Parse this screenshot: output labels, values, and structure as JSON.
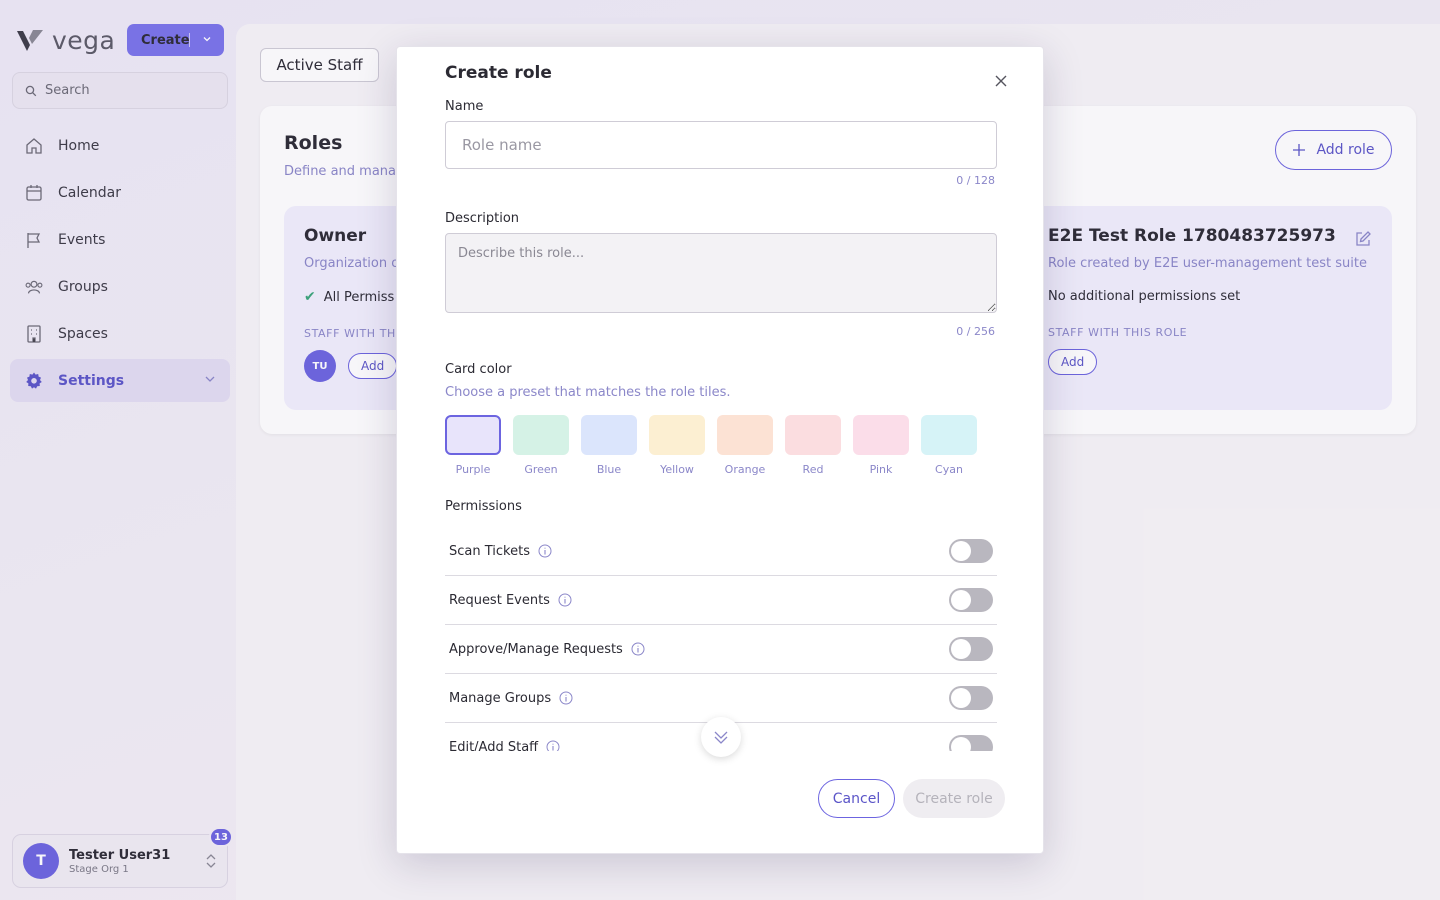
{
  "app": {
    "name": "vega",
    "create_label": "Create"
  },
  "search": {
    "placeholder": "Search"
  },
  "sidebar": {
    "items": [
      {
        "label": "Home",
        "icon": "home-icon"
      },
      {
        "label": "Calendar",
        "icon": "calendar-icon"
      },
      {
        "label": "Events",
        "icon": "flag-icon"
      },
      {
        "label": "Groups",
        "icon": "users-icon"
      },
      {
        "label": "Spaces",
        "icon": "building-icon"
      },
      {
        "label": "Settings",
        "icon": "gear-icon",
        "active": true
      }
    ]
  },
  "user": {
    "initial": "T",
    "name": "Tester User31",
    "org": "Stage Org 1",
    "notifications": "13"
  },
  "page": {
    "tab": "Active Staff",
    "roles_title": "Roles",
    "roles_subtitle": "Define and manag",
    "add_role": "Add role"
  },
  "role_cards": {
    "owner": {
      "title": "Owner",
      "description": "Organization o",
      "permission": "All Permiss",
      "section": "STAFF WITH TH",
      "avatar": "TU",
      "add": "Add"
    },
    "e2e": {
      "title": "E2E Test Role 1780483725973",
      "description": "Role created by E2E user-management test suite",
      "permission": "No additional permissions set",
      "section": "STAFF WITH THIS ROLE",
      "add": "Add"
    }
  },
  "modal": {
    "title": "Create role",
    "name_label": "Name",
    "name_value": "",
    "name_placeholder": "Role name",
    "name_counter": "0 / 128",
    "desc_label": "Description",
    "desc_value": "",
    "desc_placeholder": "Describe this role...",
    "desc_counter": "0 / 256",
    "color_label": "Card color",
    "color_help": "Choose a preset that matches the role tiles.",
    "colors": [
      {
        "name": "Purple",
        "hex": "#e8e4fb",
        "selected": true
      },
      {
        "name": "Green",
        "hex": "#d5f2e6"
      },
      {
        "name": "Blue",
        "hex": "#dbe5fc"
      },
      {
        "name": "Yellow",
        "hex": "#fcefd2"
      },
      {
        "name": "Orange",
        "hex": "#fce2d4"
      },
      {
        "name": "Red",
        "hex": "#fbdde0"
      },
      {
        "name": "Pink",
        "hex": "#fbdde9"
      },
      {
        "name": "Cyan",
        "hex": "#d6f3f7"
      }
    ],
    "permissions_label": "Permissions",
    "permissions": [
      {
        "label": "Scan Tickets",
        "enabled": false
      },
      {
        "label": "Request Events",
        "enabled": false
      },
      {
        "label": "Approve/Manage Requests",
        "enabled": false
      },
      {
        "label": "Manage Groups",
        "enabled": false
      },
      {
        "label": "Edit/Add Staff",
        "enabled": false
      }
    ],
    "cancel": "Cancel",
    "submit": "Create role"
  },
  "colors": {
    "accent": "#6c64e0",
    "accent_text": "#5b55c8",
    "muted_text": "#8b87c9",
    "role_card_bg": "#f2f0fd"
  }
}
